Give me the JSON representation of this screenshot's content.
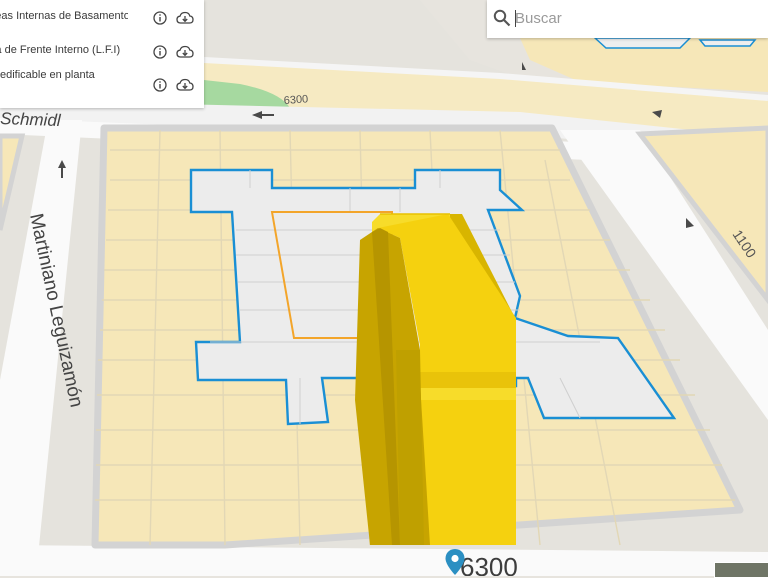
{
  "layers": [
    {
      "label": "Líneas Internas de Basamento (L.I.B)"
    },
    {
      "label": "Línea de Frente Interno (L.F.I)"
    },
    {
      "label": "Superficie edificable en planta"
    }
  ],
  "search": {
    "placeholder": "Buscar",
    "icon": "search-icon"
  },
  "street_labels": {
    "schmidl": "Schmidl",
    "martiniano": "Martiniano Leguizamón",
    "num_6300_top": "6300",
    "num_1100": "1100",
    "num_6300_bottom": "6300"
  },
  "colors": {
    "lot_fill": "#f6e7b8",
    "road": "#f2f2f2",
    "curb": "#d3d3d3",
    "basement_line": "#1a8fd4",
    "internal_front_line": "#f3a52a",
    "building": "#f5d10f",
    "pin": "#2b8fc2",
    "green": "#a6d9a0"
  }
}
